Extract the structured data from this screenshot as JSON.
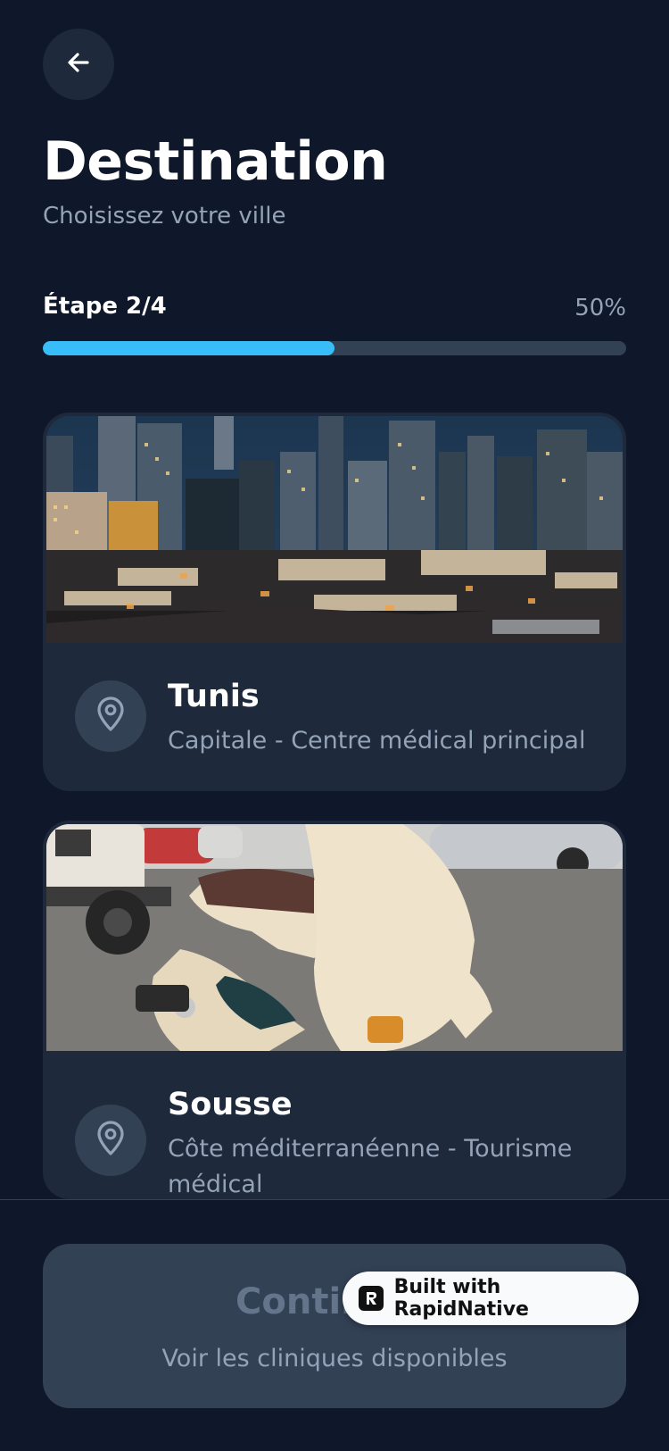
{
  "header": {
    "back_icon": "arrow-left-icon",
    "title": "Destination",
    "subtitle": "Choisissez votre ville"
  },
  "progress": {
    "step_label": "Étape 2/4",
    "percent_label": "50%",
    "value": 0.5
  },
  "cities": [
    {
      "name": "Tunis",
      "description": "Capitale - Centre médical principal",
      "icon": "map-pin-icon",
      "image": "city-night-skyline-photo"
    },
    {
      "name": "Sousse",
      "description": "Côte méditerranéenne - Tourisme médical",
      "icon": "map-pin-icon",
      "image": "cream-scooter-photo"
    }
  ],
  "footer": {
    "continue_label": "Continuer",
    "continue_sub": "Voir les cliniques disponibles"
  },
  "badge": {
    "label": "Built with RapidNative"
  },
  "colors": {
    "background": "#0f172a",
    "card": "#1e293b",
    "accent": "#38bdf8",
    "muted_text": "#94a3b8"
  }
}
